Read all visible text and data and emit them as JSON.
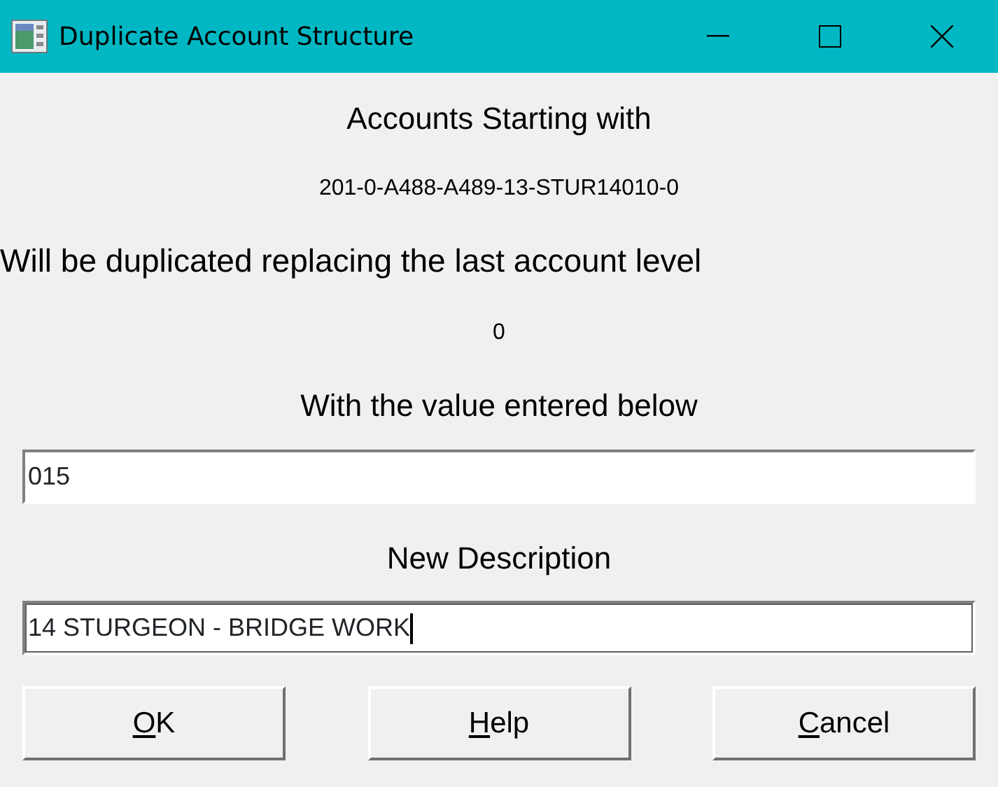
{
  "window": {
    "title": "Duplicate Account Structure"
  },
  "labels": [
    {
      "text": "Accounts Starting with",
      "kind": "heading"
    },
    {
      "text": "201-0-A488-A489-13-STUR14010-0",
      "kind": "small"
    },
    {
      "text": "Will be duplicated replacing the last account level",
      "kind": "left"
    },
    {
      "text": "0",
      "kind": "small"
    },
    {
      "text": "With the value entered below",
      "kind": "heading"
    }
  ],
  "value_field": {
    "value": "015"
  },
  "description_label": "New Description",
  "description_field": {
    "value": "14 STURGEON - BRIDGE WORK",
    "focused": true
  },
  "buttons": [
    {
      "mnemonic": "O",
      "rest": "K"
    },
    {
      "mnemonic": "H",
      "rest": "elp"
    },
    {
      "mnemonic": "C",
      "rest": "ancel"
    }
  ]
}
